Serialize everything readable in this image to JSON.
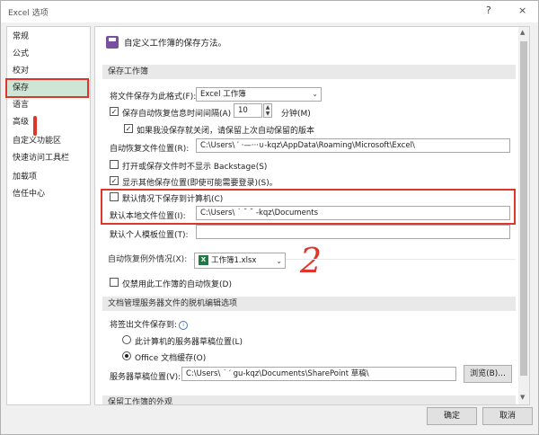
{
  "window": {
    "title": "Excel 选项",
    "help": "?",
    "close": "×"
  },
  "sidebar": {
    "items": [
      {
        "label": "常规"
      },
      {
        "label": "公式"
      },
      {
        "label": "校对"
      },
      {
        "label": "保存"
      },
      {
        "label": "语言"
      },
      {
        "label": "高级"
      },
      {
        "label": "自定义功能区"
      },
      {
        "label": "快速访问工具栏"
      },
      {
        "label": "加载项"
      },
      {
        "label": "信任中心"
      }
    ],
    "active_index": 3
  },
  "main": {
    "header": "自定义工作簿的保存方法。",
    "sections": {
      "save": "保存工作簿",
      "autorecover_except": "自动恢复例外情况(X):",
      "offline": "文档管理服务器文件的脱机编辑选项",
      "appearance": "保留工作簿的外观"
    },
    "save_format_label": "将文件保存为此格式(F):",
    "save_format_value": "Excel 工作簿",
    "autorecover_interval_label": "保存自动恢复信息时间间隔(A)",
    "autorecover_interval_value": "10",
    "minutes_label": "分钟(M)",
    "keep_last_label": "如果我没保存就关闭，请保留上次自动保留的版本",
    "autorecover_location_label": "自动恢复文件位置(R):",
    "autorecover_location_value": "C:\\Users\\ ′ ·—···∪-kqz\\AppData\\Roaming\\Microsoft\\Excel\\",
    "no_backstage_label": "打开或保存文件时不显示 Backstage(S)",
    "show_other_locations_label": "显示其他保存位置(即使可能需要登录)(S)。",
    "default_save_computer_label": "默认情况下保存到计算机(C)",
    "default_local_location_label": "默认本地文件位置(I):",
    "default_local_location_value": "C:\\Users\\ ˙ ˘ ˘ -kqz\\Documents",
    "default_template_label": "默认个人模板位置(T):",
    "default_template_value": "",
    "except_workbook": "工作簿1.xlsx",
    "disable_autorecover_label": "仅禁用此工作簿的自动恢复(D)",
    "checkout_label": "将签出文件保存到:",
    "radio_server": "此计算机的服务器草稿位置(L)",
    "radio_office": "Office 文档缓存(O)",
    "server_drafts_label": "服务器草稿位置(V):",
    "server_drafts_value": "C:\\Users\\ ˙ ′ gu-kqz\\Documents\\SharePoint 草稿\\",
    "browse_label": "浏览(B)...",
    "annotation": "2"
  },
  "footer": {
    "ok": "确定",
    "cancel": "取消"
  },
  "colors": {
    "highlight": "#e0352b",
    "active_bg": "#cfe6d6"
  },
  "icons": [
    "save-icon",
    "excel-file-icon",
    "info-icon",
    "dropdown-arrow-icon"
  ]
}
